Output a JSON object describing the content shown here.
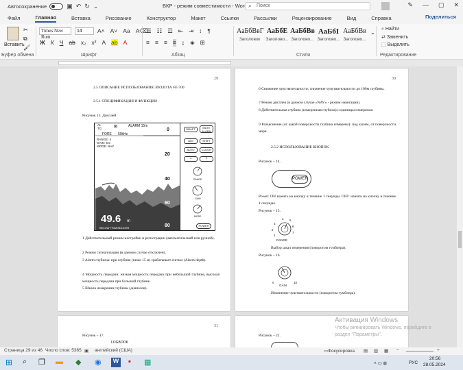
{
  "titlebar": {
    "autosave_label": "Автосохранение",
    "title": "ВКР  -  режим совместимости  -  Word",
    "search_placeholder": "Поиск"
  },
  "tabs": [
    "Файл",
    "Главная",
    "Вставка",
    "Рисование",
    "Конструктор",
    "Макет",
    "Ссылки",
    "Рассылки",
    "Рецензирование",
    "Вид",
    "Справка"
  ],
  "share_label": "Поделиться",
  "ribbon": {
    "paste_label": "Вставить",
    "clipboard_label": "Буфер обмена",
    "font_name": "Times New Rom",
    "font_size": "14",
    "font_label": "Шрифт",
    "paragraph_label": "Абзац",
    "styles_label": "Стили",
    "editing_label": "Редактирование",
    "styles": [
      {
        "sample": "АаБбВвГ",
        "name": "Заголовок"
      },
      {
        "sample": "АаБбЕ",
        "name": "Заголово..."
      },
      {
        "sample": "АаБбВв",
        "name": "Заголово..."
      },
      {
        "sample": "АаБбІ",
        "name": "Заголово..."
      },
      {
        "sample": "АаБбВв",
        "name": "Заголово..."
      }
    ],
    "find_label": "Найти",
    "replace_label": "Заменить",
    "select_label": "Выделить"
  },
  "page29": {
    "num": "29",
    "heading": "2.5 ОПИСАНИЕ ИСПОЛЬЗОВАНИЯ ЭХОЛОТА FE-700",
    "subheading": "2.5.1 СПЕЦИФИКАЦИЯ И ФУНКЦИИ",
    "figure_caption": "Рисунок 13. Дисплей",
    "display": {
      "top_left": "AL",
      "tg": "TG",
      "alarm": "ALARM 15m",
      "zero": "0",
      "fore": "FORE",
      "freq": "50kHz",
      "range": "RANGE: 4",
      "gain": "GAIN: 5.5",
      "mode": "MODE: NAV",
      "d20": "20",
      "d40": "40",
      "d60": "60",
      "d80": "80",
      "depth_value": "49.6",
      "unit": "m",
      "below": "BELOW TRANSDUCER",
      "draft": "DRAFT",
      "mute_alarm": "MUTE ALARM",
      "dim": "DIM",
      "shift": "SHIFT",
      "auto": "AUTO",
      "color": "COLOR",
      "range_knob": "RANGE",
      "gain_knob": "GAIN",
      "mode_knob": "MODE",
      "power": "POWER",
      "minus": "−",
      "plus": "+"
    },
    "items": [
      "1   Действительный режим настройки и регистрации (автоматический или ручной).",
      "2   Режим сигнализации (в данном случае отключен).",
      "3   Alarm глубины: при глубине (ниже 15 м) срабатывает сигнал (Alarm depth).",
      "4   Мощность передачи: низкая мощность передачи при небольшой глубине, высокая мощность передачи при большой глубине.",
      "5   Шкала измерения глубины (диапазон)."
    ]
  },
  "page30": {
    "num": "30",
    "items": [
      "6   Снижение чувствительности: снижение чувствительности до 100м глубины.",
      "7   Режим дисплея (в данном случае «NAV» - режим навигации).",
      "8   Действительная глубина (измеренная глубина) и единицы измерения.",
      "9   Разъяснение (от какой поверхности глубина измерена): под килем, от поверхности моря."
    ],
    "item9_line2": "чателя, под килем, от поверхности моря.",
    "heading": "2.5.2 ИСПОЛЬЗОВАНИЕ КНОПОК",
    "fig14": "Рисунок – 14.",
    "power_label": "POWER",
    "power_text": "Power: ON нажать на кнопку в течение 1 секунды. OFF: нажать на кнопку в течение 1 секунды.",
    "fig15": "Рисунок – 15.",
    "range_label": "RANGE",
    "range_desc": "Выбор шкал измерения (поворотом тумблера).",
    "fig16": "Рисунок – 16.",
    "gain_label": "GAIN",
    "gain_desc": "Изменение чувствительности (поворотом тумблера)."
  },
  "page31": {
    "num": "31",
    "fig17": "Рисунок – 17.",
    "logbook": "LOGBOOK"
  },
  "page32": {
    "fig22": "Рисунок – 22."
  },
  "watermark": {
    "title": "Активация Windows",
    "sub1": "Чтобы активировать Windows, перейдите в",
    "sub2": "раздел \"Параметры\"."
  },
  "status": {
    "page": "Страница 29 из 46",
    "words": "Число слов: 5365",
    "lang": "английский (США)",
    "focus": "Фокусировка"
  },
  "taskbar": {
    "lang": "РУС",
    "time": "20:56",
    "date": "28.05.2024"
  }
}
